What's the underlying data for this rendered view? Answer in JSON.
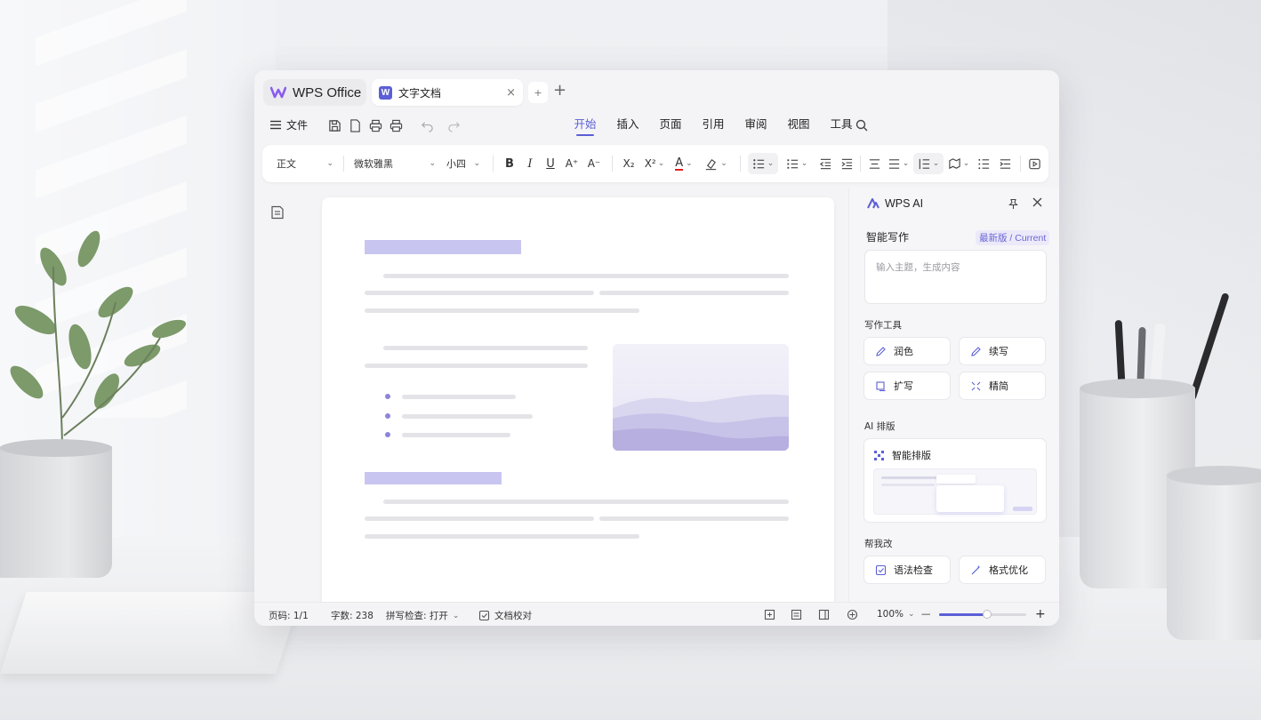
{
  "app": {
    "brand": "WPS Office",
    "accent": "#5b5fd6"
  },
  "tabs": [
    {
      "icon": "word-doc-icon",
      "label": "文字文档",
      "close": "×"
    }
  ],
  "tabbar": {
    "mini_plus": "+",
    "new_tab": "+"
  },
  "menu": {
    "file_label": "文件",
    "tabs": [
      "开始",
      "插入",
      "页面",
      "引用",
      "审阅",
      "视图",
      "工具"
    ],
    "active_tab": 0
  },
  "toolbar": {
    "style": "正文",
    "font": "微软雅黑",
    "size": "小四",
    "bold": "B",
    "italic": "I",
    "underline": "U",
    "grow": "A⁺",
    "shrink": "A⁻",
    "subscript": "X₂",
    "superscript": "X²",
    "font_color": "A",
    "font_color_value": "#e02020"
  },
  "ai_panel": {
    "title": "WPS AI",
    "section_writing": "智能写作",
    "version": "最新版 / Current",
    "prompt_placeholder": "输入主题，生成内容",
    "tools_label": "写作工具",
    "tools": [
      "润色",
      "续写",
      "扩写",
      "精简"
    ],
    "layout_label": "AI 排版",
    "layout_card": "智能排版",
    "help_label": "帮我改",
    "help": [
      "语法检查",
      "格式优化"
    ]
  },
  "status": {
    "page": "页码: 1/1",
    "words": "字数: 238",
    "spell": "拼写检查: 打开",
    "proof": "文档校对",
    "zoom": "100%",
    "zoom_fraction": 0.55,
    "minus": "—",
    "plus": "+"
  }
}
